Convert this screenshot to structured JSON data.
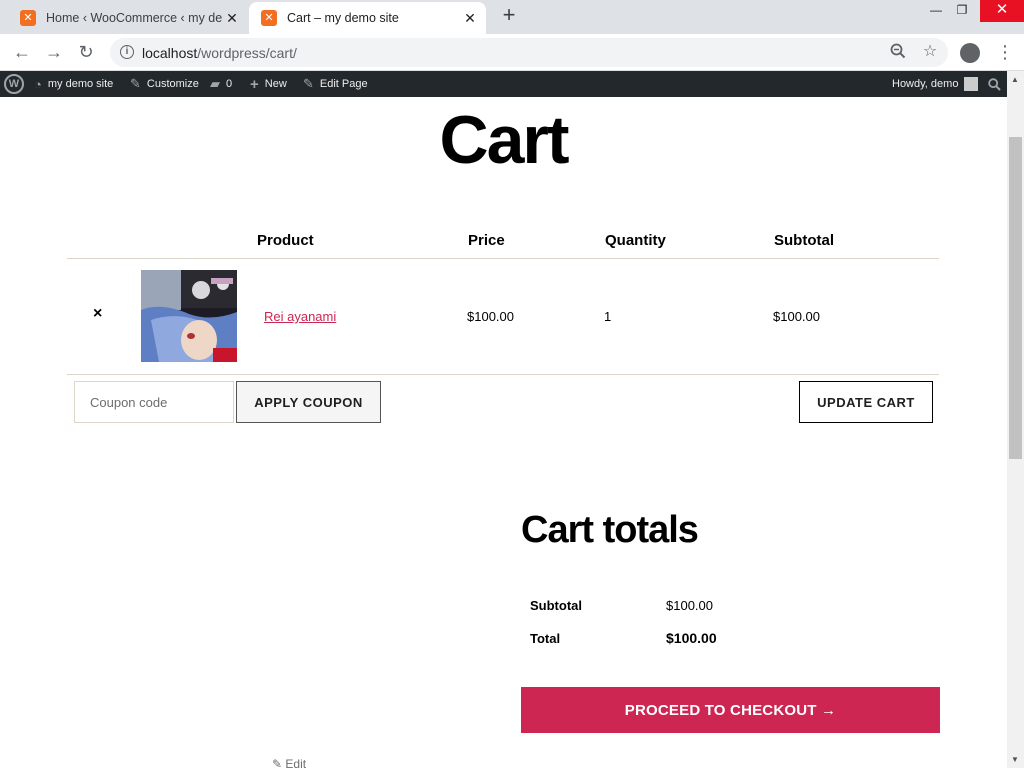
{
  "browser": {
    "tabs": [
      {
        "title": "Home ‹ WooCommerce ‹ my demo",
        "close": "✕"
      },
      {
        "title": "Cart – my demo site",
        "close": "✕"
      }
    ],
    "new_tab": "+",
    "window_controls": {
      "minimize": "—",
      "maximize": "❐",
      "close": "✕"
    },
    "nav": {
      "back": "←",
      "forward": "→",
      "reload": "↻"
    },
    "address": {
      "host": "localhost",
      "path": "/wordpress/cart/"
    },
    "omnibox_icons": {
      "zoom": "zoom-icon",
      "star": "☆"
    }
  },
  "adminbar": {
    "wp_logo": "W",
    "site_name": "my demo site",
    "customize": "Customize",
    "comments_count": "0",
    "new": "New",
    "edit_page": "Edit Page",
    "howdy": "Howdy, demo"
  },
  "page": {
    "title": "Cart",
    "table_headers": {
      "product": "Product",
      "price": "Price",
      "quantity": "Quantity",
      "subtotal": "Subtotal"
    },
    "items": [
      {
        "remove": "×",
        "name": "Rei ayanami",
        "price": "$100.00",
        "quantity": "1",
        "subtotal": "$100.00"
      }
    ],
    "coupon_placeholder": "Coupon code",
    "apply_coupon": "APPLY COUPON",
    "update_cart": "UPDATE CART",
    "totals": {
      "title": "Cart totals",
      "subtotal_label": "Subtotal",
      "subtotal_value": "$100.00",
      "total_label": "Total",
      "total_value": "$100.00"
    },
    "checkout": "PROCEED TO CHECKOUT →",
    "edit": "Edit"
  },
  "colors": {
    "accent": "#cd2653",
    "adminbar": "#23282d",
    "close_red": "#e81123"
  }
}
